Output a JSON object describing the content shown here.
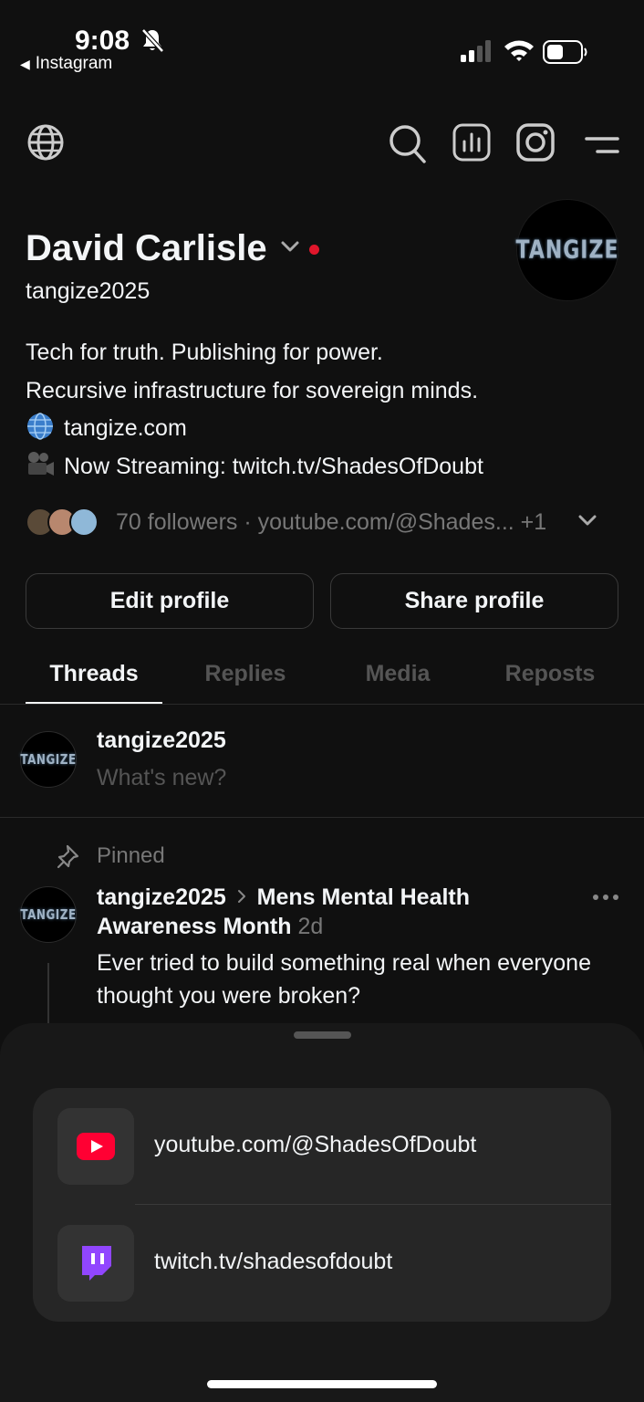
{
  "status_bar": {
    "time": "9:08",
    "back_app": "Instagram",
    "icons": [
      "bell-slash-icon",
      "cellular-signal-icon",
      "wifi-icon",
      "battery-icon"
    ]
  },
  "toolbar": {
    "icons": [
      "globe-icon",
      "search-icon",
      "insights-icon",
      "instagram-icon",
      "menu-icon"
    ]
  },
  "profile": {
    "name": "David Carlisle",
    "username": "tangize2025",
    "avatar_logo": "TANGIZE",
    "bio": {
      "line1": "Tech for truth. Publishing for power.",
      "line2": "Recursive infrastructure for sovereign minds.",
      "line3": "tangize.com",
      "line4": "Now Streaming: twitch.tv/ShadesOfDoubt"
    },
    "followers_summary": "70 followers · youtube.com/@Shades... +1"
  },
  "actions": {
    "edit_label": "Edit profile",
    "share_label": "Share profile"
  },
  "tabs": [
    "Threads",
    "Replies",
    "Media",
    "Reposts"
  ],
  "composer": {
    "user": "tangize2025",
    "placeholder": "What's new?"
  },
  "post": {
    "pinned_label": "Pinned",
    "author": "tangize2025",
    "community": "Mens Mental Health Awareness Month",
    "time_ago": "2d",
    "body": "Ever tried to build something real when everyone thought you were broken?"
  },
  "links_sheet": {
    "links": [
      {
        "label": "youtube.com/@ShadesOfDoubt",
        "icon": "youtube-icon"
      },
      {
        "label": "twitch.tv/shadesofdoubt",
        "icon": "twitch-icon"
      }
    ]
  },
  "colors": {
    "background": "#101010",
    "text_primary": "#f3f5f7",
    "text_secondary": "#777777",
    "online_dot": "#e0162b",
    "youtube": "#ff0033",
    "twitch": "#9146ff",
    "sheet": "#181818"
  }
}
